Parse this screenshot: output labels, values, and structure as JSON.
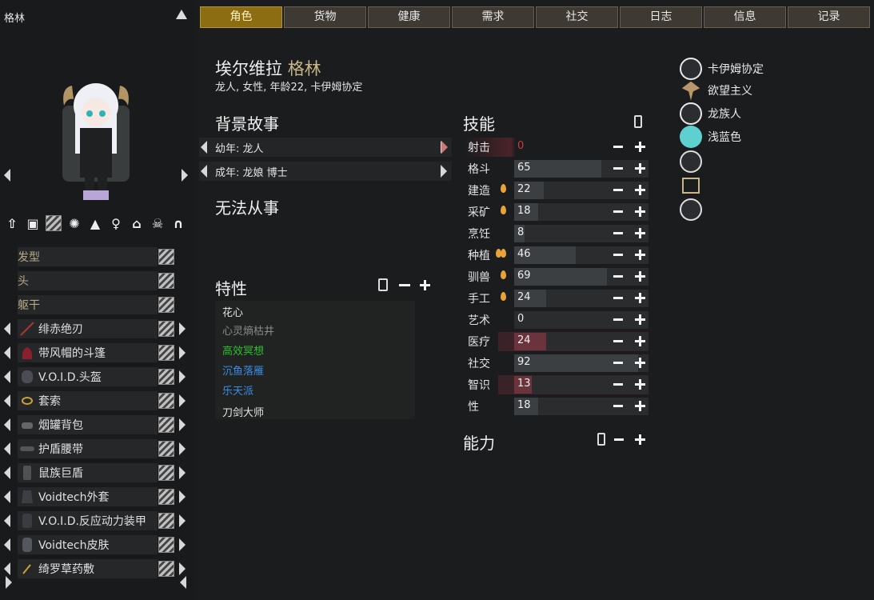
{
  "pawn": {
    "short_name": "格林",
    "full_name_first": "埃尔维拉",
    "full_name_last": "格林",
    "description": "龙人, 女性, 年龄22, 卡伊姆协定"
  },
  "tabs": [
    "角色",
    "货物",
    "健康",
    "需求",
    "社交",
    "日志",
    "信息",
    "记录"
  ],
  "active_tab": 0,
  "apparel_slots": {
    "plain": [
      "发型",
      "头",
      "躯干"
    ],
    "items": [
      "绯赤绝刃",
      "带风帽的斗篷",
      "V.O.I.D.头盔",
      "套索",
      "烟罐背包",
      "护盾腰带",
      "鼠族巨盾",
      "Voidtech外套",
      "V.O.I.D.反应动力装甲",
      "Voidtech皮肤",
      "绮罗草药敷"
    ]
  },
  "backstory": {
    "heading": "背景故事",
    "childhood": "幼年: 龙人",
    "adulthood": "成年: 龙娘 博士"
  },
  "incapable": {
    "heading": "无法从事"
  },
  "traits": {
    "heading": "特性",
    "list": [
      {
        "name": "花心",
        "color": "#e4e4e4"
      },
      {
        "name": "心灵熵枯井",
        "color": "#8a8a8a"
      },
      {
        "name": "高效冥想",
        "color": "#2fbf2f"
      },
      {
        "name": "沉鱼落雁",
        "color": "#3a8ee6"
      },
      {
        "name": "乐天派",
        "color": "#3a8ee6"
      },
      {
        "name": "刀剑大师",
        "color": "#e4e4e4"
      }
    ]
  },
  "skills": {
    "heading": "技能",
    "list": [
      {
        "name": "射击",
        "value": "0",
        "level": 0,
        "passion": 0,
        "disabled": true
      },
      {
        "name": "格斗",
        "value": "65",
        "level": 65,
        "passion": 0
      },
      {
        "name": "建造",
        "value": "22",
        "level": 22,
        "passion": 1
      },
      {
        "name": "采矿",
        "value": "18",
        "level": 18,
        "passion": 1
      },
      {
        "name": "烹饪",
        "value": "8",
        "level": 8,
        "passion": 0
      },
      {
        "name": "种植",
        "value": "46",
        "level": 46,
        "passion": 2
      },
      {
        "name": "驯兽",
        "value": "69",
        "level": 69,
        "passion": 1
      },
      {
        "name": "手工",
        "value": "24",
        "level": 24,
        "passion": 1
      },
      {
        "name": "艺术",
        "value": "0",
        "level": 0,
        "passion": 0
      },
      {
        "name": "医疗",
        "value": "24",
        "level": 24,
        "passion": 0,
        "highlight": true
      },
      {
        "name": "社交",
        "value": "92",
        "level": 92,
        "passion": 0
      },
      {
        "name": "智识",
        "value": "13",
        "level": 13,
        "passion": 0,
        "highlight": true
      },
      {
        "name": "性",
        "value": "18",
        "level": 18,
        "passion": 0
      }
    ]
  },
  "abilities": {
    "heading": "能力"
  },
  "factions": [
    {
      "label": "卡伊姆协定",
      "icon": "faction-face-icon",
      "color": "#e9e9e9"
    },
    {
      "label": "欲望主义",
      "icon": "ideology-icon",
      "color": "#b8966a"
    },
    {
      "label": "龙族人",
      "icon": "xenotype-icon",
      "color": "#e9e9e9"
    },
    {
      "label": "浅蓝色",
      "icon": "favorite-color-icon",
      "color": "#5fd0d0"
    },
    {
      "label": "",
      "icon": "role-star-icon",
      "color": "#dcdcdc"
    },
    {
      "label": "",
      "icon": "title-crown-icon",
      "color": "#c8b686"
    },
    {
      "label": "",
      "icon": "psylink-icon",
      "color": "#dcdcdc"
    }
  ],
  "colors": {
    "accent": "#8c6d12",
    "disabled_skill": "#cc3b3b",
    "highlight_bar": "#6b343d"
  }
}
